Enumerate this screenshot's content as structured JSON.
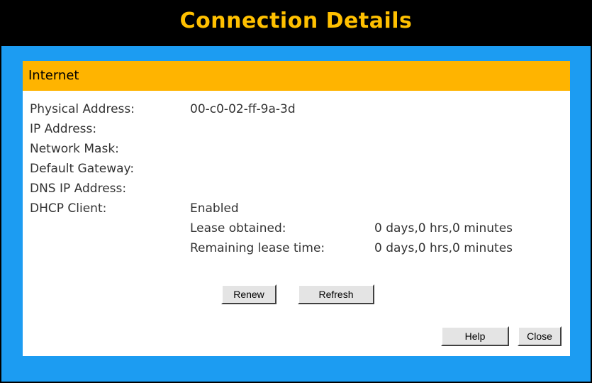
{
  "window": {
    "title": "Connection Details"
  },
  "section": {
    "title": "Internet"
  },
  "details": [
    {
      "label": "Physical Address:",
      "value": "00-c0-02-ff-9a-3d"
    },
    {
      "label": "IP Address:",
      "value": ""
    },
    {
      "label": "Network Mask:",
      "value": ""
    },
    {
      "label": "Default Gateway:",
      "value": ""
    },
    {
      "label": "DNS IP Address:",
      "value": ""
    },
    {
      "label": "DHCP Client:",
      "value": "Enabled"
    }
  ],
  "lease": [
    {
      "label": "Lease obtained:",
      "value": "0 days,0 hrs,0 minutes"
    },
    {
      "label": "Remaining lease time:",
      "value": "0 days,0 hrs,0 minutes"
    }
  ],
  "buttons": {
    "renew": "Renew",
    "refresh": "Refresh",
    "help": "Help",
    "close": "Close"
  },
  "colors": {
    "title_bar": "#000000",
    "title_text": "#ffc000",
    "frame": "#1c9cf2",
    "section_header": "#ffb400",
    "panel": "#ffffff"
  }
}
